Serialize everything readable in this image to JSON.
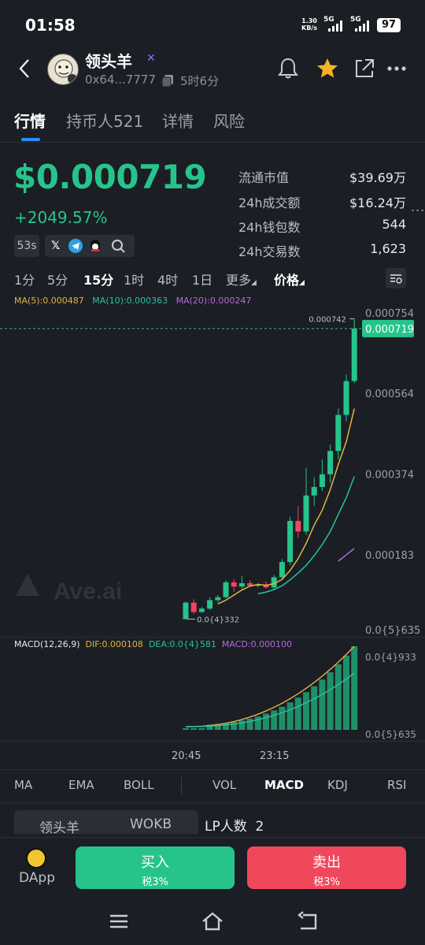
{
  "status": {
    "time": "01:58",
    "net_speed": "1.30",
    "net_unit": "KB/s",
    "sim1": "5G",
    "sim2": "5G",
    "battery": "97"
  },
  "token": {
    "name": "领头羊",
    "address": "0x64...7777",
    "age": "5时6分"
  },
  "tabs": [
    "行情",
    "持币人521",
    "详情",
    "风险"
  ],
  "price": {
    "value": "$0.000719",
    "change": "+2049.57%",
    "timer": "53s"
  },
  "stats": [
    {
      "label": "流通市值",
      "value": "$39.69万"
    },
    {
      "label": "24h成交额",
      "value": "$16.24万"
    },
    {
      "label": "24h钱包数",
      "value": "544"
    },
    {
      "label": "24h交易数",
      "value": "1,623"
    }
  ],
  "intervals": [
    "1分",
    "5分",
    "15分",
    "1时",
    "4时",
    "1日",
    "更多",
    "价格"
  ],
  "active_interval": "15分",
  "ma_legend": {
    "ma5": "MA(5):0.000487",
    "ma10": "MA(10):0.000363",
    "ma20": "MA(20):0.000247"
  },
  "chart_data": {
    "type": "candlestick",
    "y_ticks": [
      "0.000754",
      "0.000564",
      "0.000374",
      "0.000183",
      "0.0{5}635"
    ],
    "current_price_tag": "0.000719",
    "high_label": "0.000742",
    "low_label": "0.0{4}332",
    "watermark": "Ave.ai",
    "x_labels": [
      "20:45",
      "23:15"
    ],
    "candles": [
      {
        "o": 3.3e-05,
        "h": 7.5e-05,
        "l": 3.3e-05,
        "c": 7.2e-05
      },
      {
        "o": 7.2e-05,
        "h": 8e-05,
        "l": 4.5e-05,
        "c": 5e-05
      },
      {
        "o": 5e-05,
        "h": 6.2e-05,
        "l": 4.8e-05,
        "c": 5.8e-05
      },
      {
        "o": 5.8e-05,
        "h": 8.5e-05,
        "l": 5.5e-05,
        "c": 7.8e-05
      },
      {
        "o": 7.8e-05,
        "h": 9e-05,
        "l": 7.2e-05,
        "c": 8.5e-05
      },
      {
        "o": 8.5e-05,
        "h": 0.000125,
        "l": 8.2e-05,
        "c": 0.00012
      },
      {
        "o": 0.00012,
        "h": 0.000128,
        "l": 9.8e-05,
        "c": 0.00011
      },
      {
        "o": 0.00011,
        "h": 0.000135,
        "l": 0.000105,
        "c": 0.000118
      },
      {
        "o": 0.000118,
        "h": 0.000125,
        "l": 0.00011,
        "c": 0.000112
      },
      {
        "o": 0.000112,
        "h": 0.000118,
        "l": 0.000108,
        "c": 0.000115
      },
      {
        "o": 0.000115,
        "h": 0.000122,
        "l": 0.000105,
        "c": 0.000108
      },
      {
        "o": 0.000108,
        "h": 0.000138,
        "l": 0.000102,
        "c": 0.000132
      },
      {
        "o": 0.000132,
        "h": 0.000175,
        "l": 0.000128,
        "c": 0.000168
      },
      {
        "o": 0.000168,
        "h": 0.000275,
        "l": 0.00016,
        "c": 0.000265
      },
      {
        "o": 0.000265,
        "h": 0.0003,
        "l": 0.000225,
        "c": 0.00024
      },
      {
        "o": 0.00024,
        "h": 0.00039,
        "l": 0.000232,
        "c": 0.000325
      },
      {
        "o": 0.000325,
        "h": 0.000368,
        "l": 0.0003,
        "c": 0.000345
      },
      {
        "o": 0.000345,
        "h": 0.00041,
        "l": 0.000335,
        "c": 0.000375
      },
      {
        "o": 0.000375,
        "h": 0.000445,
        "l": 0.000355,
        "c": 0.00043
      },
      {
        "o": 0.00043,
        "h": 0.00053,
        "l": 0.00041,
        "c": 0.000515
      },
      {
        "o": 0.000515,
        "h": 0.00061,
        "l": 0.0005,
        "c": 0.000595
      },
      {
        "o": 0.000595,
        "h": 0.000742,
        "l": 0.00059,
        "c": 0.000719
      }
    ],
    "ma5_values": [
      null,
      null,
      null,
      null,
      6.9e-05,
      7.8e-05,
      9e-05,
      0.000102,
      0.000111,
      0.000115,
      0.000113,
      0.000117,
      0.000127,
      0.000148,
      0.000176,
      0.000212,
      0.000255,
      0.00029,
      0.000339,
      0.000398,
      0.000452,
      0.00053
    ],
    "ma10_values": [
      null,
      null,
      null,
      null,
      null,
      null,
      null,
      null,
      null,
      9.3e-05,
      9.7e-05,
      0.000103,
      0.000112,
      0.000126,
      0.000142,
      0.00016,
      0.000183,
      0.000209,
      0.00024,
      0.00028,
      0.00032,
      0.00037
    ],
    "ma20_values": [
      null,
      null,
      null,
      null,
      null,
      null,
      null,
      null,
      null,
      null,
      null,
      null,
      null,
      null,
      null,
      null,
      null,
      null,
      null,
      0.00017,
      0.000185,
      0.0002
    ]
  },
  "macd": {
    "label": "MACD(12,26,9)",
    "dif": "DIF:0.000108",
    "dea": "DEA:0.0{4}581",
    "macd": "MACD:0.000100",
    "y_ticks": [
      "0.0{4}933",
      "0.0{5}635"
    ]
  },
  "indicators": [
    "MA",
    "EMA",
    "BOLL",
    "VOL",
    "MACD",
    "KDJ",
    "RSI"
  ],
  "pair": {
    "base": "领头羊",
    "quote": "WOKB",
    "lp_label": "LP人数",
    "lp_count": "2"
  },
  "actions": {
    "dapp": "DApp",
    "buy": "买入",
    "buy_tax": "税3%",
    "sell": "卖出",
    "sell_tax": "税3%"
  },
  "colors": {
    "up": "#26c48b",
    "down": "#f0475b",
    "accent": "#2f8cf5",
    "background": "#1b1e24"
  }
}
